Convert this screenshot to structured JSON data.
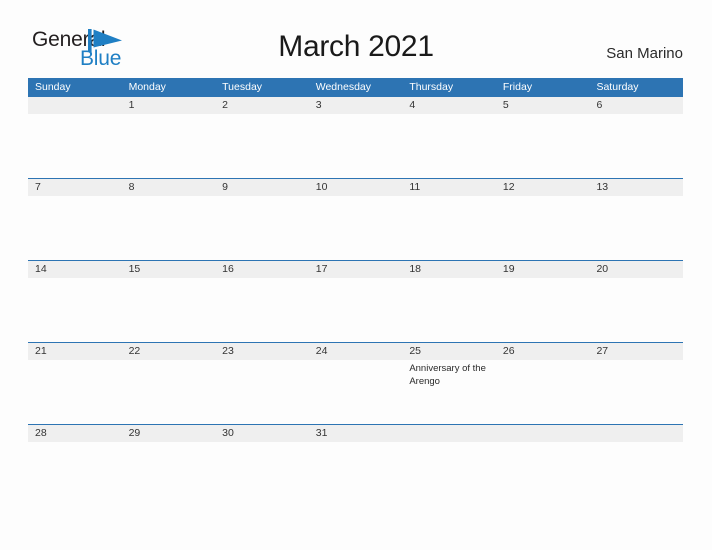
{
  "brand": {
    "name_top": "General",
    "name_bottom": "Blue",
    "mark": "triangle-flag-icon",
    "color_dark": "#231F20",
    "color_blue": "#1F7FC4"
  },
  "header": {
    "title": "March 2021",
    "locale": "San Marino"
  },
  "theme": {
    "header_blue": "#2D74B3",
    "band_gray": "#EFEFEF",
    "page_bg": "#FDFDFD",
    "text": "#333333"
  },
  "calendar": {
    "month": "March",
    "year": "2021",
    "weekdays": [
      "Sunday",
      "Monday",
      "Tuesday",
      "Wednesday",
      "Thursday",
      "Friday",
      "Saturday"
    ],
    "weeks": [
      {
        "days": [
          {
            "date": "",
            "events": []
          },
          {
            "date": "1",
            "events": []
          },
          {
            "date": "2",
            "events": []
          },
          {
            "date": "3",
            "events": []
          },
          {
            "date": "4",
            "events": []
          },
          {
            "date": "5",
            "events": []
          },
          {
            "date": "6",
            "events": []
          }
        ]
      },
      {
        "days": [
          {
            "date": "7",
            "events": []
          },
          {
            "date": "8",
            "events": []
          },
          {
            "date": "9",
            "events": []
          },
          {
            "date": "10",
            "events": []
          },
          {
            "date": "11",
            "events": []
          },
          {
            "date": "12",
            "events": []
          },
          {
            "date": "13",
            "events": []
          }
        ]
      },
      {
        "days": [
          {
            "date": "14",
            "events": []
          },
          {
            "date": "15",
            "events": []
          },
          {
            "date": "16",
            "events": []
          },
          {
            "date": "17",
            "events": []
          },
          {
            "date": "18",
            "events": []
          },
          {
            "date": "19",
            "events": []
          },
          {
            "date": "20",
            "events": []
          }
        ]
      },
      {
        "days": [
          {
            "date": "21",
            "events": []
          },
          {
            "date": "22",
            "events": []
          },
          {
            "date": "23",
            "events": []
          },
          {
            "date": "24",
            "events": []
          },
          {
            "date": "25",
            "events": [
              "Anniversary of the Arengo"
            ]
          },
          {
            "date": "26",
            "events": []
          },
          {
            "date": "27",
            "events": []
          }
        ]
      },
      {
        "days": [
          {
            "date": "28",
            "events": []
          },
          {
            "date": "29",
            "events": []
          },
          {
            "date": "30",
            "events": []
          },
          {
            "date": "31",
            "events": []
          },
          {
            "date": "",
            "events": []
          },
          {
            "date": "",
            "events": []
          },
          {
            "date": "",
            "events": []
          }
        ]
      }
    ]
  }
}
